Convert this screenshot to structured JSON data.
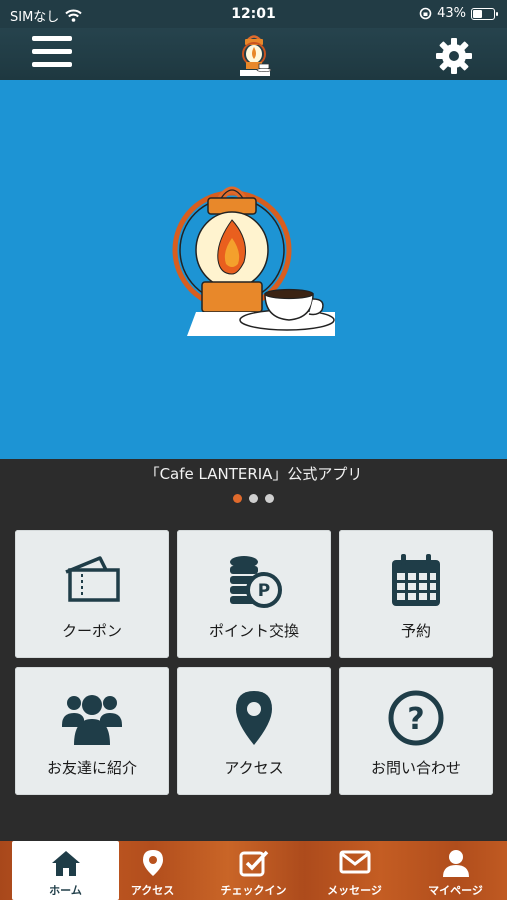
{
  "status_bar": {
    "carrier": "SIMなし",
    "time": "12:01",
    "battery": "43%",
    "battery_level": 0.43
  },
  "nav": {
    "menu_icon": "hamburger-menu-icon",
    "logo": "lantern-logo",
    "settings_icon": "gear-icon"
  },
  "hero": {
    "illustration": "lantern-and-coffee-cup",
    "background": "#1d94d4"
  },
  "carousel": {
    "caption": "「Cafe LANTERIA」公式アプリ",
    "pages": 3,
    "active_page": 1
  },
  "menu_grid": [
    {
      "label": "クーポン",
      "icon": "ticket-icon"
    },
    {
      "label": "ポイント交換",
      "icon": "coins-icon"
    },
    {
      "label": "予約",
      "icon": "calendar-icon"
    },
    {
      "label": "お友達に紹介",
      "icon": "group-icon"
    },
    {
      "label": "アクセス",
      "icon": "map-pin-icon"
    },
    {
      "label": "お問い合わせ",
      "icon": "question-icon"
    }
  ],
  "tabbar": [
    {
      "label": "ホーム",
      "icon": "home-icon",
      "active": true
    },
    {
      "label": "アクセス",
      "icon": "map-pin-icon",
      "active": false
    },
    {
      "label": "チェックイン",
      "icon": "checkbox-icon",
      "active": false
    },
    {
      "label": "メッセージ",
      "icon": "envelope-icon",
      "active": false
    },
    {
      "label": "マイページ",
      "icon": "person-icon",
      "active": false
    }
  ],
  "colors": {
    "accent": "#e06a2c",
    "header": "#223c45",
    "tile": "#e8eced",
    "icon_dark": "#1f3d48"
  }
}
